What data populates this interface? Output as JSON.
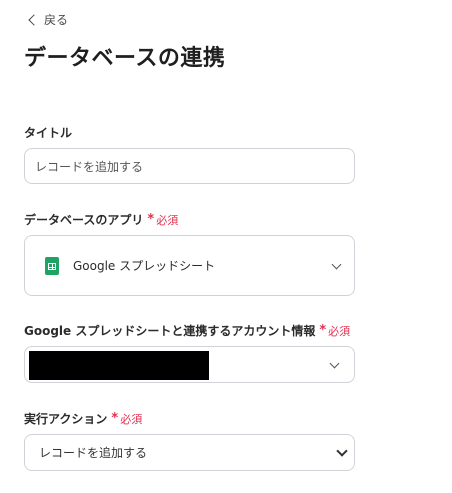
{
  "nav": {
    "back_label": "戻る"
  },
  "page": {
    "title": "データベースの連携"
  },
  "fields": {
    "title": {
      "label": "タイトル",
      "value": "レコードを追加する"
    },
    "app": {
      "label": "データベースのアプリ",
      "required": "必須",
      "value": "Google スプレッドシート",
      "icon": "google-sheets-icon"
    },
    "account": {
      "label": "Google スプレッドシートと連携するアカウント情報",
      "required": "必須"
    },
    "action": {
      "label": "実行アクション",
      "required": "必須",
      "value": "レコードを追加する"
    }
  }
}
